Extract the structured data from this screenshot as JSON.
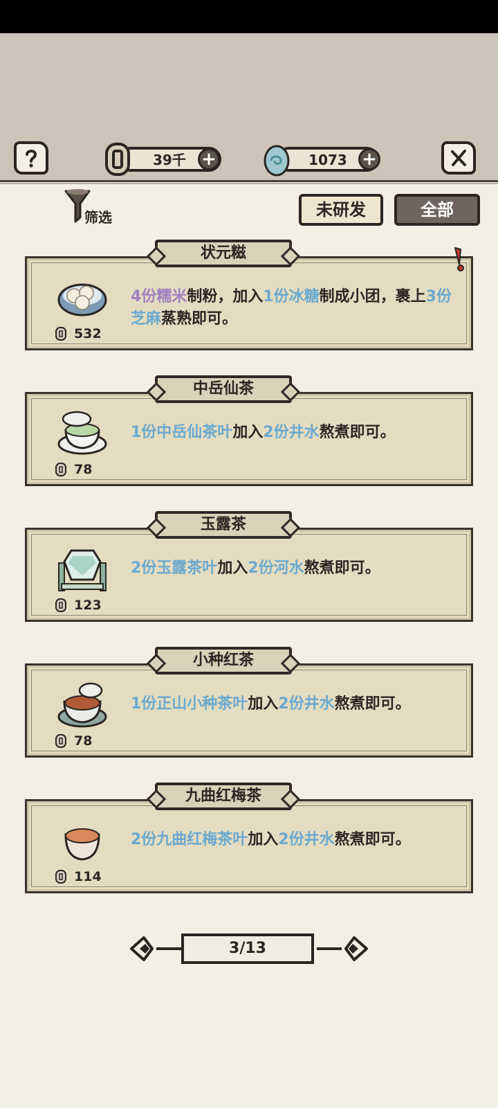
{
  "header": {
    "copper_coins": "39千",
    "jade_currency": "1073"
  },
  "filter": {
    "label": "筛选"
  },
  "tabs": [
    {
      "label": "未研发",
      "active": false
    },
    {
      "label": "全部",
      "active": true
    }
  ],
  "recipes": [
    {
      "name": "状元糍",
      "price": "532",
      "icon": "rice-dumplings-bowl-icon",
      "desc": [
        {
          "t": "4份糯米",
          "c": "purple"
        },
        {
          "t": "制粉，加入",
          "c": ""
        },
        {
          "t": "1份冰糖",
          "c": "blue"
        },
        {
          "t": "制成小团，裹上",
          "c": ""
        },
        {
          "t": "3份芝麻",
          "c": "blue"
        },
        {
          "t": "蒸熟即可。",
          "c": ""
        }
      ]
    },
    {
      "name": "中岳仙茶",
      "price": "78",
      "icon": "green-tea-cup-icon",
      "desc": [
        {
          "t": "1份中岳仙茶叶",
          "c": "blue"
        },
        {
          "t": "加入",
          "c": ""
        },
        {
          "t": "2份井水",
          "c": "blue"
        },
        {
          "t": "熬煮即可。",
          "c": ""
        }
      ]
    },
    {
      "name": "玉露茶",
      "price": "123",
      "icon": "hexagon-tea-cup-icon",
      "desc": [
        {
          "t": "2份玉露茶叶",
          "c": "blue"
        },
        {
          "t": "加入",
          "c": ""
        },
        {
          "t": "2份河水",
          "c": "blue"
        },
        {
          "t": "熬煮即可。",
          "c": ""
        }
      ]
    },
    {
      "name": "小种红茶",
      "price": "78",
      "icon": "black-tea-cup-icon",
      "desc": [
        {
          "t": "1份正山小种茶叶",
          "c": "blue"
        },
        {
          "t": "加入",
          "c": ""
        },
        {
          "t": "2份井水",
          "c": "blue"
        },
        {
          "t": "熬煮即可。",
          "c": ""
        }
      ]
    },
    {
      "name": "九曲红梅茶",
      "price": "114",
      "icon": "red-plum-tea-cup-icon",
      "desc": [
        {
          "t": "2份九曲红梅茶叶",
          "c": "blue"
        },
        {
          "t": "加入",
          "c": ""
        },
        {
          "t": "2份井水",
          "c": "blue"
        },
        {
          "t": "熬煮即可。",
          "c": ""
        }
      ]
    }
  ],
  "pagination": {
    "label": "3/13"
  },
  "colors": {
    "highlight_purple": "#a27fc0",
    "highlight_blue": "#6aa9cf",
    "card_bg": "#e4dcc0",
    "active_tab": "#6e6560"
  }
}
